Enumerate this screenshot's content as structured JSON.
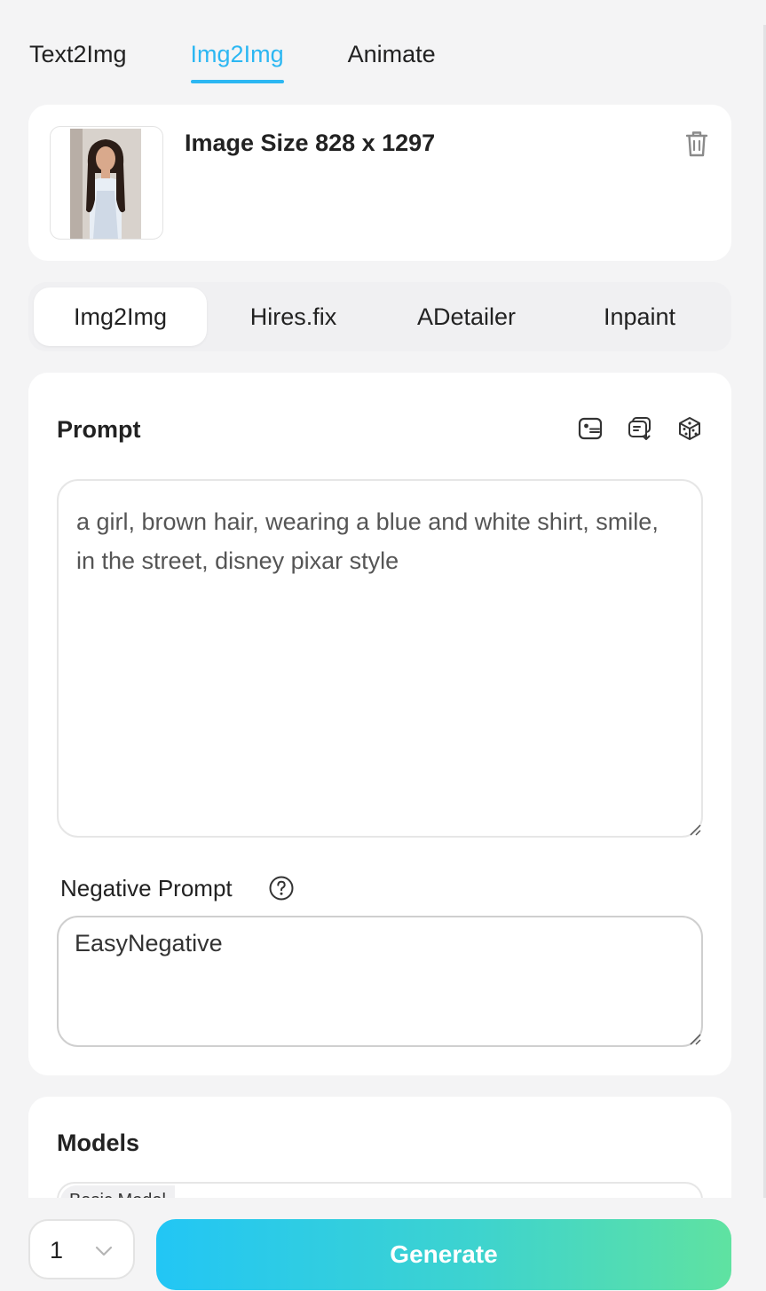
{
  "top_tabs": [
    {
      "label": "Text2Img"
    },
    {
      "label": "Img2Img"
    },
    {
      "label": "Animate"
    }
  ],
  "image_card": {
    "size_text": "Image Size 828 x 1297"
  },
  "sub_tabs": [
    {
      "label": "Img2Img"
    },
    {
      "label": "Hires.fix"
    },
    {
      "label": "ADetailer"
    },
    {
      "label": "Inpaint"
    }
  ],
  "prompt": {
    "title": "Prompt",
    "value": "a girl, brown hair, wearing a blue and white shirt, smile, in the street, disney pixar style"
  },
  "negative_prompt": {
    "label": "Negative Prompt",
    "value": "EasyNegative"
  },
  "models": {
    "title": "Models",
    "tag": "Basic Model"
  },
  "bottom_bar": {
    "quantity": "1",
    "generate_label": "Generate"
  },
  "colors": {
    "accent": "#2cb7f2",
    "generate_gradient_start": "#22c6f5",
    "generate_gradient_end": "#5fe2a1"
  },
  "icons": {
    "delete": "trash-icon",
    "prompt_tools": [
      "template-icon",
      "import-prompt-icon",
      "random-dice-icon"
    ],
    "help": "help-icon",
    "quantity_dropdown": "chevron-down-icon"
  }
}
